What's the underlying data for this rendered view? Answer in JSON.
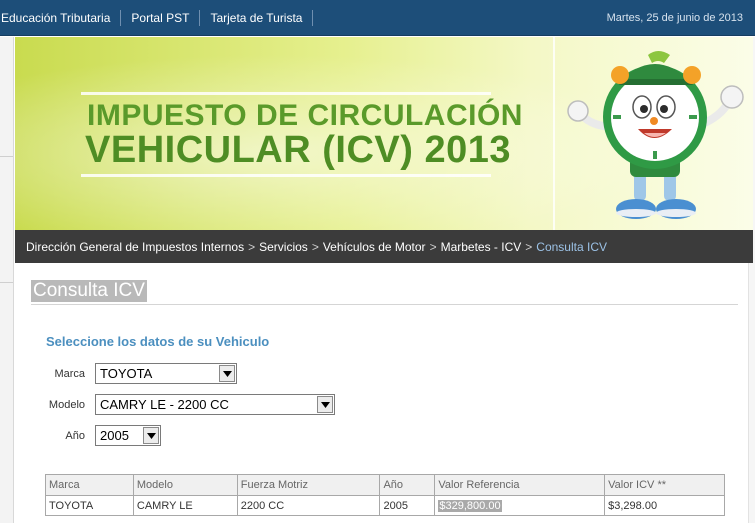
{
  "topnav": {
    "links": [
      "Educación Tributaria",
      "Portal PST",
      "Tarjeta de Turista"
    ],
    "date": "Martes, 25 de junio de 2013"
  },
  "banner": {
    "line1": "IMPUESTO DE CIRCULACIÓN",
    "line2": "VEHICULAR (ICV) 2013"
  },
  "breadcrumb": {
    "items": [
      "Dirección General de Impuestos Internos",
      "Servicios",
      "Vehículos de Motor",
      "Marbetes - ICV"
    ],
    "separator": ">",
    "current": "Consulta ICV"
  },
  "page": {
    "title": "Consulta ICV"
  },
  "form": {
    "heading": "Seleccione los datos de su Vehiculo",
    "marca": {
      "label": "Marca",
      "value": "TOYOTA"
    },
    "modelo": {
      "label": "Modelo",
      "value": "CAMRY LE - 2200 CC"
    },
    "anio": {
      "label": "Año",
      "value": "2005"
    }
  },
  "results": {
    "headers": [
      "Marca",
      "Modelo",
      "Fuerza Motriz",
      "Año",
      "Valor Referencia",
      "Valor ICV **"
    ],
    "rows": [
      [
        "TOYOTA",
        "CAMRY LE",
        "2200 CC",
        "2005",
        "$329,800.00",
        "$3,298.00"
      ]
    ]
  },
  "colors": {
    "topbar": "#1d4e79",
    "breadcrumb_bg": "#3b3b3b",
    "breadcrumb_current": "#9cc2e6",
    "heading_blue": "#4b8fbf",
    "banner_green": "#4e8d24"
  }
}
